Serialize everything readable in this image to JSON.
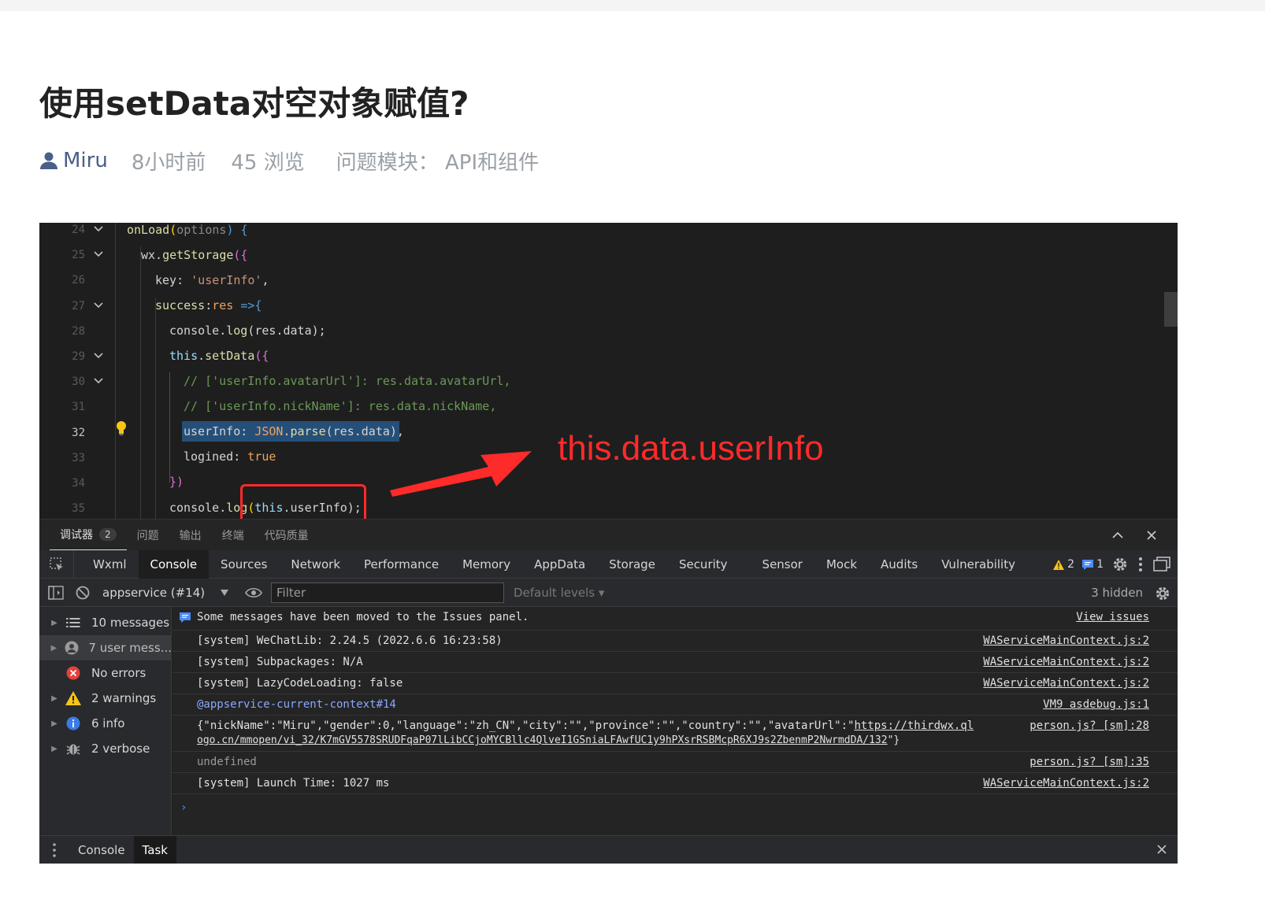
{
  "question": {
    "title": "使用setData对空对象赋值?",
    "author": "Miru",
    "time": "8小时前",
    "views": "45 浏览",
    "module": "问题模块：  API和组件"
  },
  "editor": {
    "lines": [
      {
        "num": "24",
        "fold": true
      },
      {
        "num": "25",
        "fold": true
      },
      {
        "num": "26",
        "fold": false
      },
      {
        "num": "27",
        "fold": true
      },
      {
        "num": "28",
        "fold": false
      },
      {
        "num": "29",
        "fold": true
      },
      {
        "num": "30",
        "fold": true
      },
      {
        "num": "31",
        "fold": false
      },
      {
        "num": "32",
        "fold": false,
        "current": true
      },
      {
        "num": "33",
        "fold": false
      },
      {
        "num": "34",
        "fold": false
      },
      {
        "num": "35",
        "fold": false
      }
    ],
    "code": {
      "l24": {
        "a": "onLoad",
        "b": "(",
        "c": "options",
        "d": ") {"
      },
      "l25": {
        "a": "wx.",
        "b": "getStorage",
        "c": "({"
      },
      "l26": {
        "a": "key: ",
        "b": "'userInfo'",
        "c": ","
      },
      "l27": {
        "a": "success",
        "b": ":",
        "c": "res",
        "d": " =>{"
      },
      "l28": {
        "a": "console.",
        "b": "log",
        "c": "(res.data);"
      },
      "l29": {
        "a": "this",
        "b": ".",
        "c": "setData",
        "d": "({"
      },
      "l30": {
        "a": "// ['userInfo.avatarUrl']: res.data.avatarUrl,"
      },
      "l31": {
        "a": "// ['userInfo.nickName']: res.data.nickName,"
      },
      "l32": {
        "a": "userInfo: ",
        "b": "JSON",
        "c": ".",
        "d": "parse",
        "e": "(res.data),"
      },
      "l33": {
        "a": "logined: ",
        "b": "true"
      },
      "l34": {
        "a": "})"
      },
      "l35": {
        "a": "console.",
        "b": "log",
        "c": "(",
        "d": "this",
        "e": ".userInfo);"
      }
    },
    "annotation": "this.data.userInfo"
  },
  "panel_tabs": [
    {
      "label": "调试器",
      "badge": "2",
      "active": true
    },
    {
      "label": "问题",
      "active": false
    },
    {
      "label": "输出",
      "active": false
    },
    {
      "label": "终端",
      "active": false
    },
    {
      "label": "代码质量",
      "active": false
    }
  ],
  "devtools_tabs": [
    "Wxml",
    "Console",
    "Sources",
    "Network",
    "Performance",
    "Memory",
    "AppData",
    "Storage",
    "Security",
    "Sensor",
    "Mock",
    "Audits",
    "Vulnerability"
  ],
  "devtools_active": "Console",
  "counts": {
    "warnings": "2",
    "info": "1"
  },
  "filter_bar": {
    "context": "appservice (#14)",
    "filter_placeholder": "Filter",
    "levels": "Default levels",
    "hidden": "3 hidden"
  },
  "sidebar": [
    {
      "label": "10 messages",
      "icon": "list-icon"
    },
    {
      "label": "7 user mess...",
      "icon": "user-icon"
    },
    {
      "label": "No errors",
      "icon": "error-icon"
    },
    {
      "label": "2 warnings",
      "icon": "warning-icon"
    },
    {
      "label": "6 info",
      "icon": "info-icon"
    },
    {
      "label": "2 verbose",
      "icon": "bug-icon"
    }
  ],
  "messages": [
    {
      "text": "Some messages have been moved to the Issues panel.",
      "source": "View issues"
    },
    {
      "text": "[system] WeChatLib: 2.24.5 (2022.6.6 16:23:58)",
      "source": "WAServiceMainContext.js:2"
    },
    {
      "text": "[system] Subpackages: N/A",
      "source": "WAServiceMainContext.js:2"
    },
    {
      "text": "[system] LazyCodeLoading: false",
      "source": "WAServiceMainContext.js:2"
    },
    {
      "text": "@appservice-current-context#14",
      "source": "VM9 asdebug.js:1"
    },
    {
      "text": "{\"nickName\":\"Miru\",\"gender\":0,\"language\":\"zh_CN\",\"city\":\"\",\"province\":\"\",\"country\":\"\",\"avatarUrl\":\"",
      "link1": "https://thirdwx.ql",
      "link2": "ogo.cn/mmopen/vi_32/K7mGV5578SRUDFqaP07lLibCCjoMYCBllc4QlveI1GSniaLFAwfUC1y9hPXsrRSBMcpR6XJ9s2ZbenmP2NwrmdDA/132",
      "tail": "\"}",
      "source": "person.js? [sm]:28"
    },
    {
      "text": "undefined",
      "source": "person.js? [sm]:35"
    },
    {
      "text": "[system] Launch Time: 1027 ms",
      "source": "WAServiceMainContext.js:2"
    }
  ],
  "prompt": "›",
  "drawer_tabs": [
    {
      "label": "Console",
      "active": false
    },
    {
      "label": "Task",
      "active": true
    }
  ],
  "colors": {
    "annotation": "#ff2a2a",
    "accent_blue": "#4a8cff",
    "warning": "#f5c518",
    "error": "#e5413a"
  }
}
